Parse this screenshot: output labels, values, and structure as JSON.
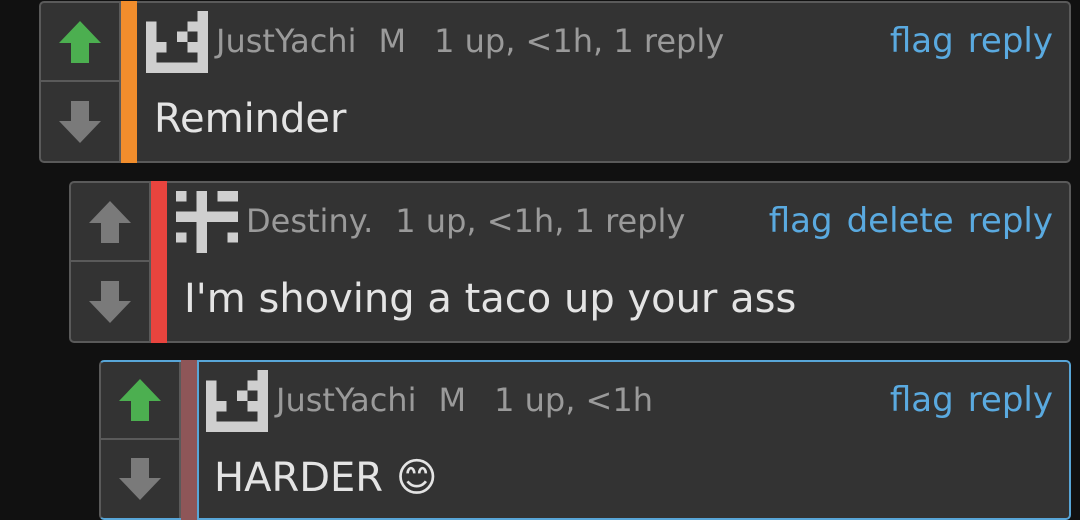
{
  "colors": {
    "background": "#111111",
    "panel": "#333333",
    "border": "#5a5a5a",
    "link": "#5aaae0",
    "meta_text": "#9a9a9a",
    "body_text": "#e4e4e4",
    "upvote_active": "#4caf50",
    "vote_inactive": "#7a7a7a"
  },
  "comments": [
    {
      "username": "JustYachi",
      "role": "M",
      "stats": "1 up, <1h, 1 reply",
      "actions": [
        "flag",
        "reply"
      ],
      "text": "Reminder",
      "stripe_color": "#f18d2c",
      "upvoted": true,
      "avatar_icon": "pixel-avatar-icon"
    },
    {
      "username": "Destiny.",
      "role": "",
      "stats": "1 up, <1h, 1 reply",
      "actions": [
        "flag",
        "delete",
        "reply"
      ],
      "text": "I'm shoving a taco up your ass",
      "stripe_color": "#e8443e",
      "upvoted": false,
      "avatar_icon": "pixel-avatar-icon"
    },
    {
      "username": "JustYachi",
      "role": "M",
      "stats": "1 up, <1h",
      "actions": [
        "flag",
        "reply"
      ],
      "text": "HARDER 😊",
      "stripe_color": "#8e5658",
      "upvoted": true,
      "avatar_icon": "pixel-avatar-icon"
    }
  ]
}
